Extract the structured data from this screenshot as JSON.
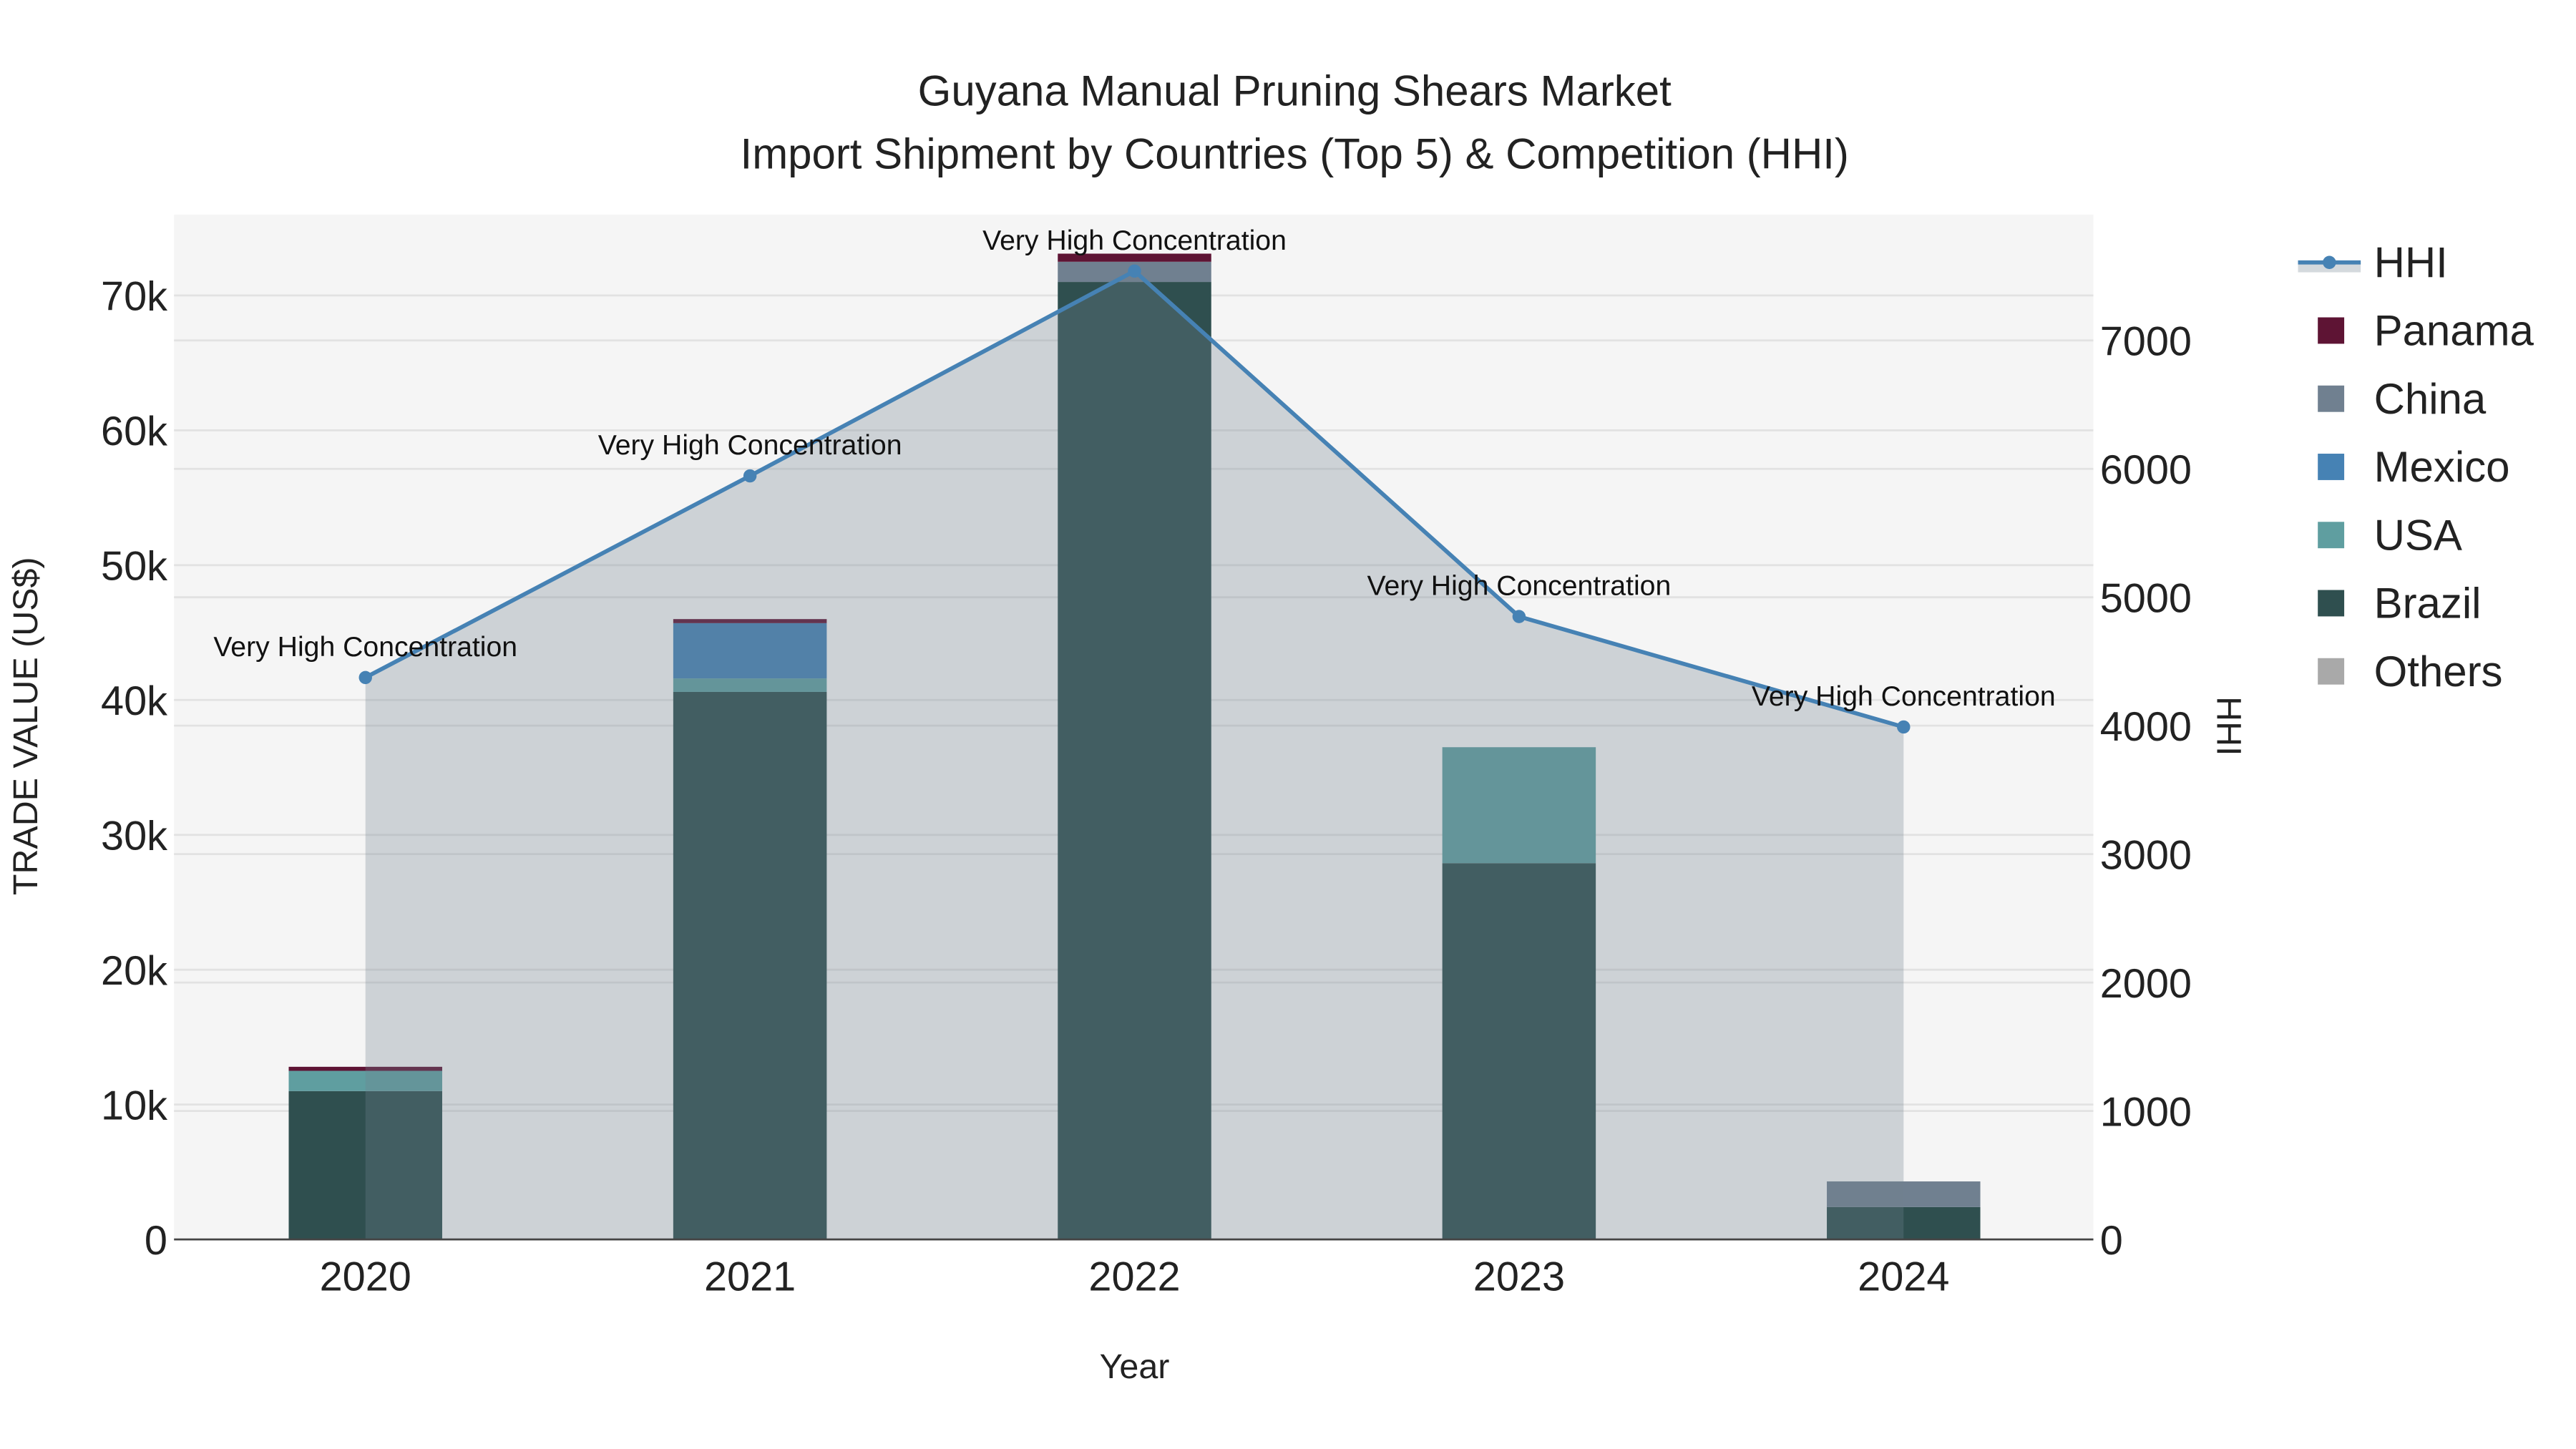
{
  "chart_data": {
    "type": "bar",
    "title_line1": "Guyana Manual Pruning Shears Market",
    "title_line2": "Import Shipment by Countries (Top 5) & Competition (HHI)",
    "xlabel": "Year",
    "ylabel": "TRADE VALUE (US$)",
    "y2label": "HHI",
    "categories": [
      "2020",
      "2021",
      "2022",
      "2023",
      "2024"
    ],
    "ylim": [
      0,
      76000
    ],
    "y2lim": [
      0,
      7980
    ],
    "yticks": [
      0,
      10000,
      20000,
      30000,
      40000,
      50000,
      60000,
      70000
    ],
    "ytick_labels": [
      "0",
      "10k",
      "20k",
      "30k",
      "40k",
      "50k",
      "60k",
      "70k"
    ],
    "y2ticks": [
      0,
      1000,
      2000,
      3000,
      4000,
      5000,
      6000,
      7000
    ],
    "y2tick_labels": [
      "0",
      "1000",
      "2000",
      "3000",
      "4000",
      "5000",
      "6000",
      "7000"
    ],
    "barmode": "stack",
    "series": [
      {
        "name": "Brazil",
        "color": "#2f4f4f",
        "values": [
          11000,
          40600,
          71000,
          27900,
          2400
        ]
      },
      {
        "name": "USA",
        "color": "#5f9ea0",
        "values": [
          1500,
          1000,
          0,
          8600,
          0
        ]
      },
      {
        "name": "Mexico",
        "color": "#4682b4",
        "values": [
          0,
          4100,
          0,
          0,
          0
        ]
      },
      {
        "name": "China",
        "color": "#708090",
        "values": [
          0,
          0,
          1500,
          0,
          1900
        ]
      },
      {
        "name": "Panama",
        "color": "#5e1434",
        "values": [
          300,
          300,
          600,
          0,
          0
        ]
      },
      {
        "name": "Others",
        "color": "#a9a9a9",
        "values": [
          0,
          0,
          0,
          0,
          0
        ]
      }
    ],
    "hhi": {
      "name": "HHI",
      "color": "#4682b4",
      "values": [
        4375,
        5945,
        7540,
        4850,
        3990
      ]
    },
    "annotations": [
      "Very High Concentration",
      "Very High Concentration",
      "Very High Concentration",
      "Very High Concentration",
      "Very High Concentration"
    ],
    "legend_order": [
      "HHI",
      "Panama",
      "China",
      "Mexico",
      "USA",
      "Brazil",
      "Others"
    ],
    "legend_position": "right",
    "grid": true
  }
}
